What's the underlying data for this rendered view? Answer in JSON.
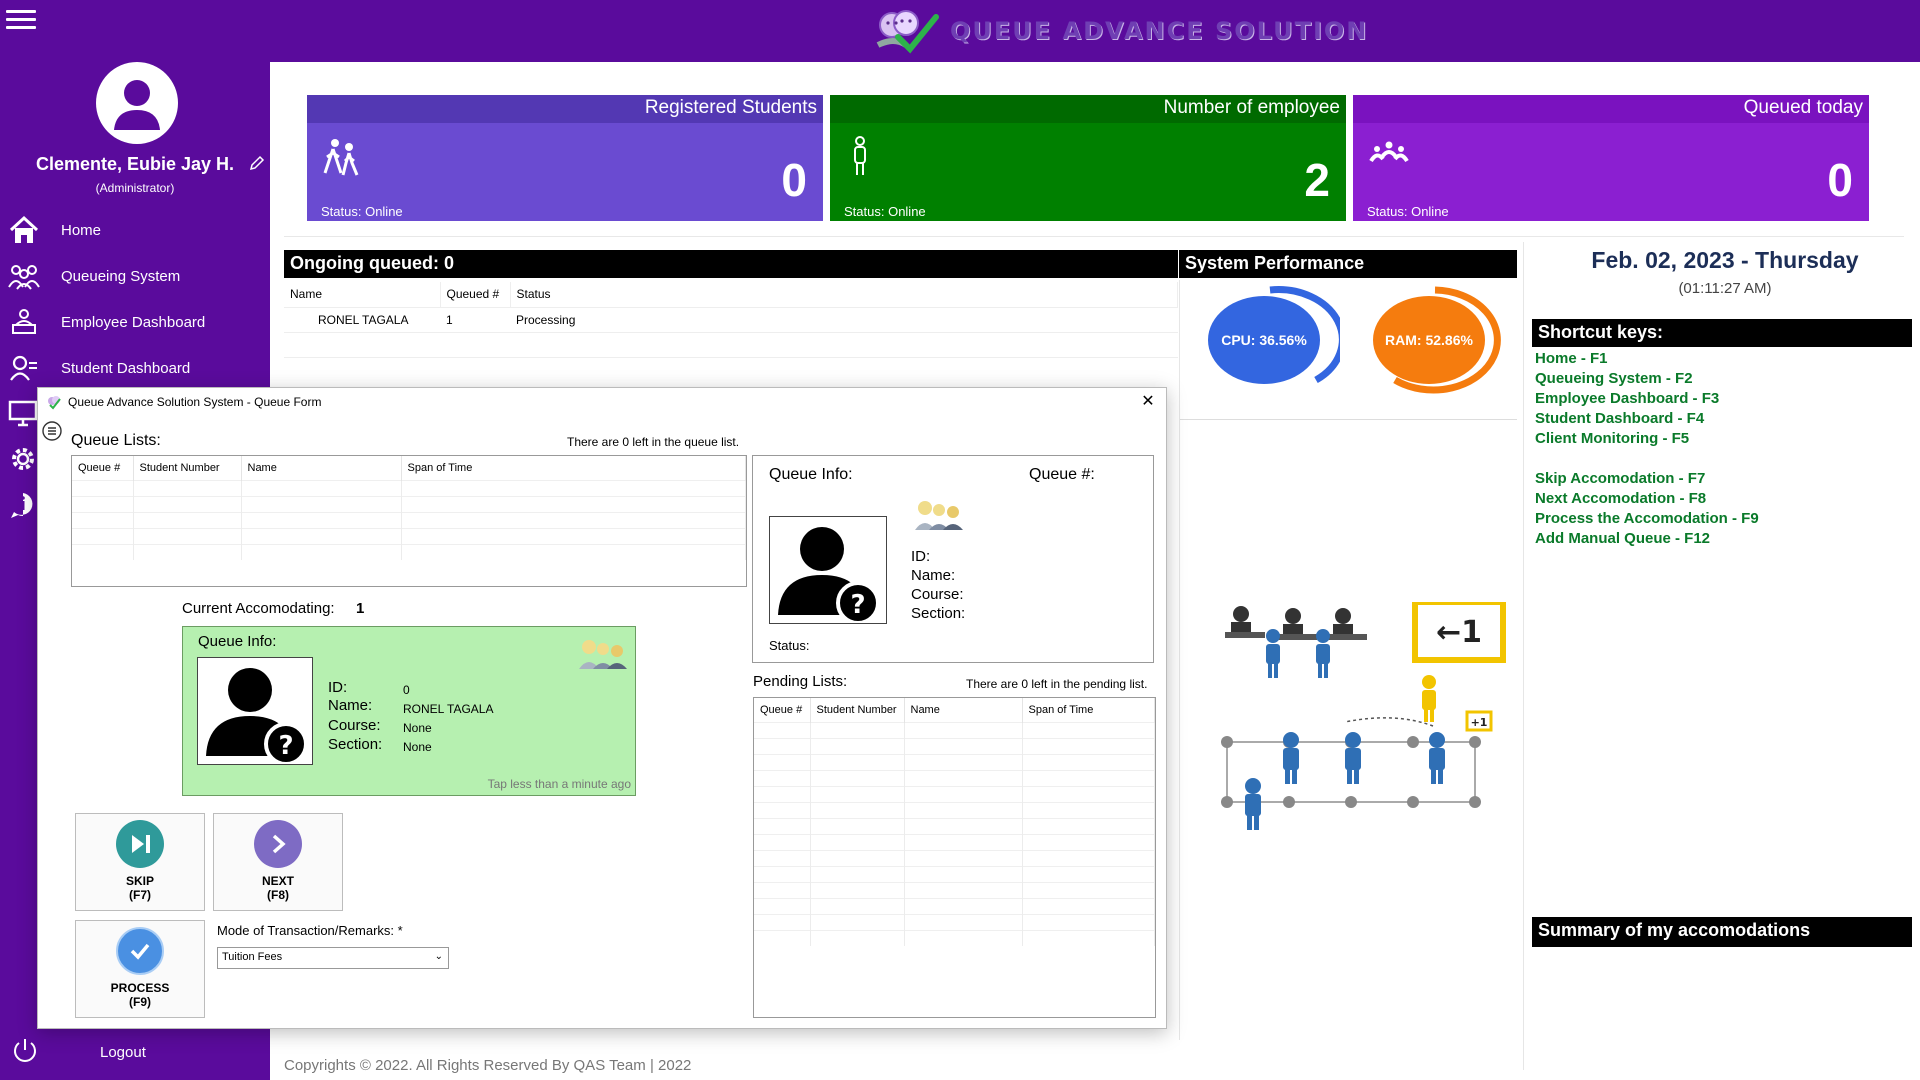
{
  "header": {
    "logo_text": "QUEUE ADVANCE SOLUTION"
  },
  "sidebar": {
    "user_name": "Clemente, Eubie Jay H.",
    "user_role": "(Administrator)",
    "items": [
      {
        "label": "Home",
        "icon": "home-icon"
      },
      {
        "label": "Queueing System",
        "icon": "people-icon"
      },
      {
        "label": "Employee Dashboard",
        "icon": "employee-icon"
      },
      {
        "label": "Student Dashboard",
        "icon": "student-icon"
      }
    ],
    "logout_label": "Logout"
  },
  "cards": {
    "students": {
      "title": "Registered Students",
      "value": "0",
      "status": "Status: Online"
    },
    "employee": {
      "title": "Number of employee",
      "value": "2",
      "status": "Status: Online"
    },
    "queued": {
      "title": "Queued today",
      "value": "0",
      "status": "Status: Online"
    }
  },
  "ongoing": {
    "header": "Ongoing queued: 0",
    "columns": [
      "Name",
      "Queued #",
      "Status"
    ],
    "rows": [
      {
        "name": "RONEL TAGALA",
        "queued": "1",
        "status": "Processing"
      }
    ]
  },
  "system": {
    "header": "System Performance",
    "cpu": "CPU: 36.56%",
    "ram": "RAM: 52.86%",
    "cpu_color": "#3366e0",
    "ram_color": "#f57c0e"
  },
  "date": {
    "date": "Feb. 02, 2023 - Thursday",
    "time": "(01:11:27 AM)"
  },
  "shortcuts": {
    "header": "Shortcut keys:",
    "items": [
      "Home - F1",
      "Queueing System - F2",
      "Employee Dashboard - F3",
      "Student Dashboard - F4",
      "Client Monitoring - F5",
      "Skip Accomodation - F7",
      "Next Accomodation - F8",
      "Process the Accomodation - F9",
      "Add Manual Queue - F12"
    ]
  },
  "summary": {
    "header": "Summary of my accomodations"
  },
  "footer": {
    "copyright": "Copyrights © 2022. All Rights Reserved By QAS Team  |  2022"
  },
  "modal": {
    "title": "Queue Advance Solution System - Queue Form",
    "queue_lists_label": "Queue Lists:",
    "queue_left_note": "There are 0 left in the queue list.",
    "queue_columns": [
      "Queue #",
      "Student Number",
      "Name",
      "Span of Time"
    ],
    "queue_info": {
      "title": "Queue Info:",
      "queue_no_label": "Queue #:",
      "id_label": "ID:",
      "name_label": "Name:",
      "course_label": "Course:",
      "section_label": "Section:",
      "status_label": "Status:"
    },
    "current": {
      "label": "Current Accomodating:",
      "number": "1",
      "title": "Queue Info:",
      "id_label": "ID:",
      "id_value": "0",
      "name_label": "Name:",
      "name_value": "RONEL TAGALA",
      "course_label": "Course:",
      "course_value": "None",
      "section_label": "Section:",
      "section_value": "None",
      "tap_note": "Tap less than a minute ago"
    },
    "pending_label": "Pending Lists:",
    "pending_note": "There are 0 left in the pending list.",
    "pending_columns": [
      "Queue #",
      "Student Number",
      "Name",
      "Span of Time"
    ],
    "buttons": {
      "skip": "SKIP",
      "skip_key": "(F7)",
      "next": "NEXT",
      "next_key": "(F8)",
      "process": "PROCESS",
      "process_key": "(F9)"
    },
    "mode_label": "Mode of Transaction/Remarks: *",
    "mode_value": "Tuition Fees"
  }
}
